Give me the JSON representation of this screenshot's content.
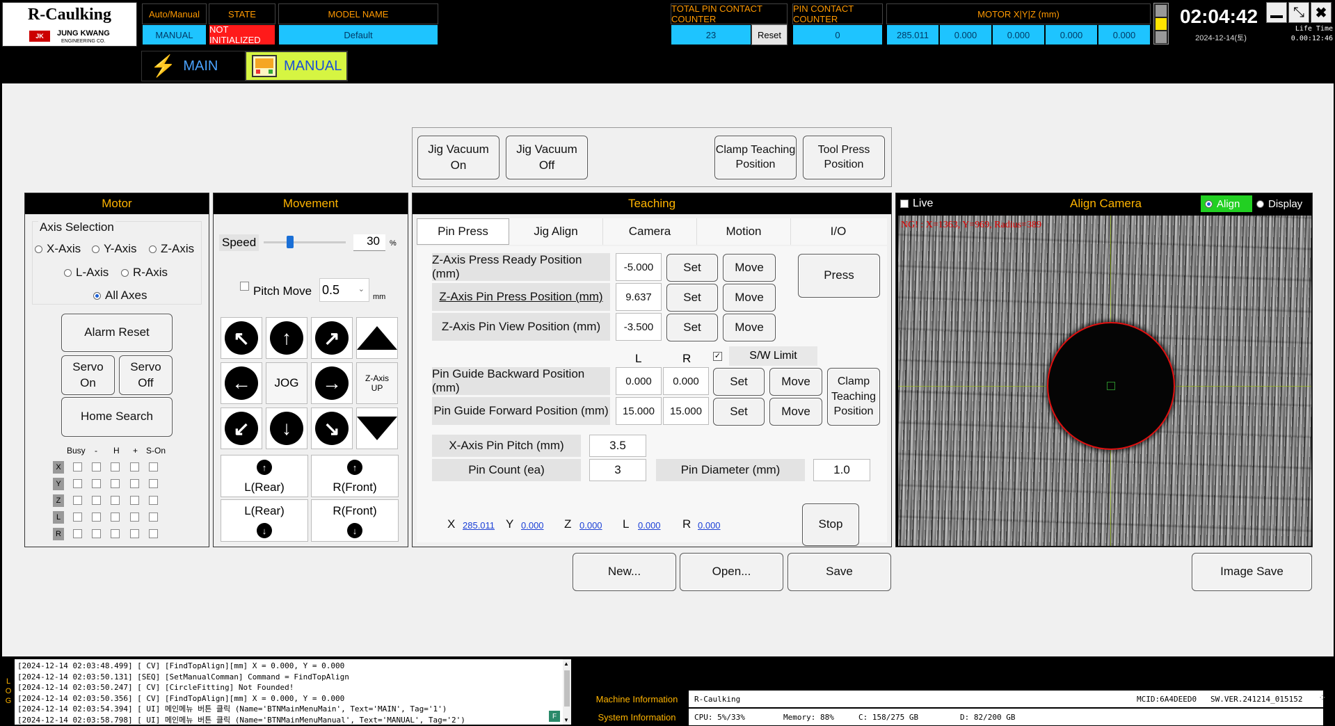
{
  "header": {
    "logo_title": "R-Caulking",
    "logo_company": "JUNG KWANG",
    "logo_sub": "ENGINEERING CO.",
    "auto_manual_label": "Auto/Manual",
    "auto_manual_value": "MANUAL",
    "state_label": "STATE",
    "state_value": "NOT INITIALIZED",
    "model_label": "MODEL NAME",
    "model_value": "Default",
    "total_pin_label": "TOTAL PIN CONTACT COUNTER",
    "total_pin_value": "23",
    "reset_label": "Reset",
    "pin_contact_label": "PIN CONTACT COUNTER",
    "pin_contact_value": "0",
    "motor_label": "MOTOR X|Y|Z (mm)",
    "motor_values": [
      "285.011",
      "0.000",
      "0.000",
      "0.000",
      "0.000"
    ],
    "clock": "02:04:42",
    "date": "2024-12-14(토)",
    "life_time_label": "Life Time",
    "life_time_value": "0.00:12:46"
  },
  "nav": {
    "main_label": "MAIN",
    "manual_label": "MANUAL"
  },
  "top_buttons": {
    "jig_vacuum_on": "Jig Vacuum\nOn",
    "jig_vacuum_off": "Jig Vacuum\nOff",
    "clamp_teaching": "Clamp Teaching\nPosition",
    "tool_press": "Tool Press\nPosition"
  },
  "motor": {
    "title": "Motor",
    "axis_selection": "Axis Selection",
    "axes": [
      "X-Axis",
      "Y-Axis",
      "Z-Axis",
      "L-Axis",
      "R-Axis",
      "All Axes"
    ],
    "selected_axis": "All Axes",
    "alarm_reset": "Alarm Reset",
    "servo_on": "Servo\nOn",
    "servo_off": "Servo\nOff",
    "home_search": "Home Search",
    "status_headers": [
      "Busy",
      "-",
      "H",
      "+",
      "S-On"
    ],
    "status_rows": [
      "X",
      "Y",
      "Z",
      "L",
      "R"
    ]
  },
  "movement": {
    "title": "Movement",
    "speed_label": "Speed",
    "speed_value": "30",
    "speed_unit": "%",
    "pitch_move_label": "Pitch Move",
    "pitch_value": "0.5",
    "pitch_unit": "mm",
    "jog_label": "JOG",
    "z_up_label": "Z-Axis\nUP",
    "l_rear_up": "L(Rear)",
    "r_front_up": "R(Front)",
    "l_rear_down": "L(Rear)",
    "r_front_down": "R(Front)"
  },
  "teaching": {
    "title": "Teaching",
    "tabs": [
      "Pin Press",
      "Jig Align",
      "Camera",
      "Motion",
      "I/O"
    ],
    "active_tab": "Pin Press",
    "rows": [
      {
        "label": "Z-Axis Press Ready Position (mm)",
        "value": "-5.000"
      },
      {
        "label": "Z-Axis Pin Press Position (mm)",
        "value": "9.637"
      },
      {
        "label": "Z-Axis Pin View Position (mm)",
        "value": "-3.500"
      }
    ],
    "set_label": "Set",
    "move_label": "Move",
    "press_label": "Press",
    "col_l": "L",
    "col_r": "R",
    "sw_limit": "S/W Limit",
    "guide_rows": [
      {
        "label": "Pin Guide Backward Position (mm)",
        "l": "0.000",
        "r": "0.000"
      },
      {
        "label": "Pin Guide Forward Position (mm)",
        "l": "15.000",
        "r": "15.000"
      }
    ],
    "clamp_teaching": "Clamp\nTeaching\nPosition",
    "x_pitch_label": "X-Axis Pin Pitch (mm)",
    "x_pitch_value": "3.5",
    "pin_count_label": "Pin Count (ea)",
    "pin_count_value": "3",
    "pin_diameter_label": "Pin Diameter (mm)",
    "pin_diameter_value": "1.0",
    "coords": [
      {
        "axis": "X",
        "value": "285.011"
      },
      {
        "axis": "Y",
        "value": "0.000"
      },
      {
        "axis": "Z",
        "value": "0.000"
      },
      {
        "axis": "L",
        "value": "0.000"
      },
      {
        "axis": "R",
        "value": "0.000"
      }
    ],
    "stop_label": "Stop"
  },
  "camera": {
    "live_label": "Live",
    "title": "Align Camera",
    "align_label": "Align",
    "display_label": "Display",
    "overlay_text": "NG! : X=1363, Y=969, Radius=389"
  },
  "bottom_buttons": {
    "new": "New...",
    "open": "Open...",
    "save": "Save",
    "image_save": "Image Save"
  },
  "log": {
    "side_label": "LOG",
    "lines": [
      "[2024-12-14 02:03:48.499] [ CV] [FindTopAlign][mm] X = 0.000, Y = 0.000",
      "[2024-12-14 02:03:50.131] [SEQ] [SetManualComman] Command = FindTopAlign",
      "[2024-12-14 02:03:50.247] [ CV] [CircleFitting] Not Founded!",
      "[2024-12-14 02:03:50.356] [ CV] [FindTopAlign][mm] X = 0.000, Y = 0.000",
      "[2024-12-14 02:03:54.394] [ UI] 메인메뉴 버튼 클릭 (Name='BTNMainMenuMain', Text='MAIN', Tag='1')",
      "[2024-12-14 02:03:58.798] [ UI] 메인메뉴 버튼 클릭 (Name='BTNMainMenuManual', Text='MANUAL', Tag='2')"
    ]
  },
  "footer": {
    "machine_info_label": "Machine Information",
    "machine_info_value": "R-Caulking",
    "mcid": "MCID:6A4DEED0",
    "sw_ver": "SW.VER.241214_015152",
    "system_info_label": "System Information",
    "cpu": "CPU: 5%/33%",
    "memory": "Memory: 88%",
    "c_drive": "C: 158/275 GB",
    "d_drive": "D: 82/200 GB"
  },
  "colors": {
    "header_cyan": "#1ec4ff",
    "header_orange": "#ff9900",
    "alarm_red": "#ff1a1a",
    "manual_yellow": "#d6f542"
  }
}
